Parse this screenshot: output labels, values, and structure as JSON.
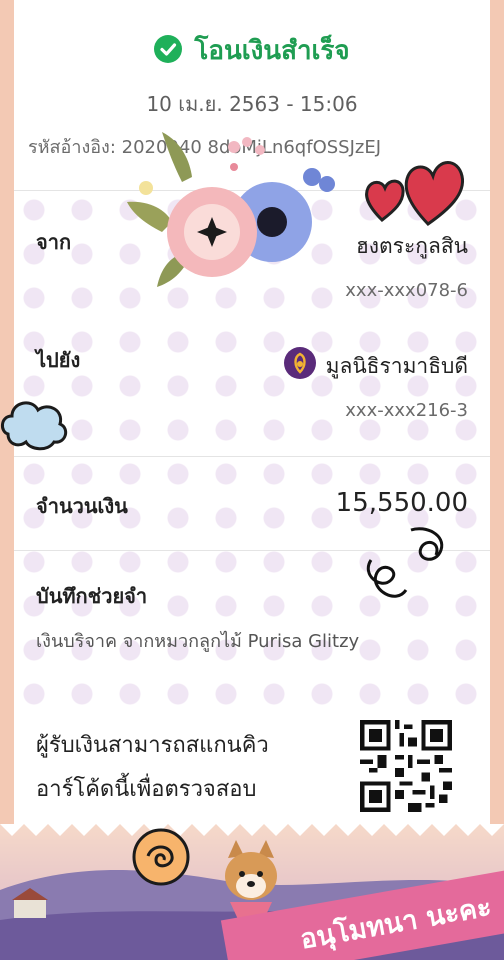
{
  "status": {
    "title": "โอนเงินสำเร็จ"
  },
  "datetime": "10 เม.ย. 2563 - 15:06",
  "reference": "รหัสอ้างอิง: 2020040 8doMjLn6qfOSSJzEJ",
  "from": {
    "label": "จาก",
    "name": "ฮงตระกูลสิน",
    "account": "xxx-xxx078-6"
  },
  "to": {
    "label": "ไปยัง",
    "name": "มูลนิธิรามาธิบดี",
    "account": "xxx-xxx216-3"
  },
  "amount": {
    "label": "จำนวนเงิน",
    "value": "15,550.00"
  },
  "memo": {
    "label": "บันทึกช่วยจำ",
    "text": "เงินบริจาค จากหมวกลูกไม้ Purisa Glitzy"
  },
  "qr_message": [
    "ผู้รับเงินสามารถสแกนคิว",
    "อาร์โค้ดนี้เพื่อตรวจสอบ"
  ],
  "banner": {
    "text": "อนุโมทนา นะคะ"
  },
  "colors": {
    "success": "#1fb05a",
    "ribbon": "#e46a9b",
    "foundation_logo": "#5a2b7a"
  }
}
